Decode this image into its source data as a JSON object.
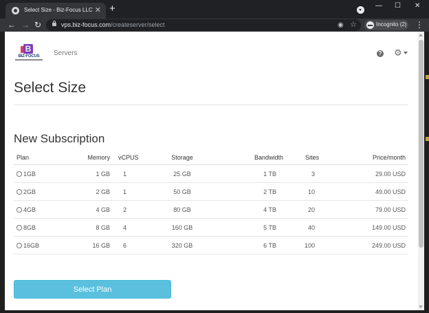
{
  "browser": {
    "tab_title": "Select Size - Biz-Focus LLC",
    "tab_close": "✕",
    "new_tab": "+",
    "url_host": "vps.biz-focus.com",
    "url_path": "/createserver/select",
    "incognito_label": "Incognito (2)",
    "window_minimize": "—",
    "window_maximize": "☐",
    "window_close": "✕",
    "icons": [
      "favicon-icon",
      "tab-search-icon",
      "back-icon",
      "forward-icon",
      "reload-icon",
      "lock-icon",
      "eye-off-icon",
      "star-icon",
      "incognito-icon",
      "kebab-menu-icon"
    ]
  },
  "header": {
    "logo_text": "BIZ-FOCUS",
    "nav_servers": "Servers",
    "help_icon": "?",
    "gear_icon": "⚙",
    "colors": {
      "logo_purple": "#7a3fb8",
      "logo_pink": "#d93a6a",
      "logo_navy": "#243a7a"
    }
  },
  "page": {
    "title": "Select Size",
    "section_title": "New Subscription"
  },
  "table": {
    "columns": [
      "Plan",
      "Memory",
      "vCPUS",
      "Storage",
      "Bandwidth",
      "Sites",
      "Price/month"
    ],
    "rows": [
      [
        "1GB",
        "1 GB",
        "1",
        "25 GB",
        "1 TB",
        "3",
        "29.00 USD"
      ],
      [
        "2GB",
        "2 GB",
        "1",
        "50 GB",
        "2 TB",
        "10",
        "49.00 USD"
      ],
      [
        "4GB",
        "4 GB",
        "2",
        "80 GB",
        "4 TB",
        "20",
        "79.00 USD"
      ],
      [
        "8GB",
        "8 GB",
        "4",
        "160 GB",
        "5 TB",
        "40",
        "149.00 USD"
      ],
      [
        "16GB",
        "16 GB",
        "6",
        "320 GB",
        "6 TB",
        "100",
        "249.00 USD"
      ]
    ]
  },
  "actions": {
    "select_plan": "Select Plan",
    "button_color": "#5bc0de"
  }
}
